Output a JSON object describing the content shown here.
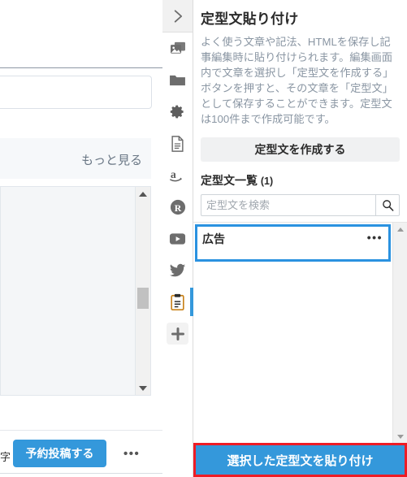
{
  "host": {
    "more_link": "もっと見る",
    "char_count_label": "字",
    "schedule_button": "予約投稿する",
    "kebab": "•••"
  },
  "rail": {
    "items": [
      {
        "name": "chevron-right-icon",
        "label": "パネルを閉じる",
        "state": "active-box"
      },
      {
        "name": "images-icon",
        "label": "画像",
        "state": ""
      },
      {
        "name": "folder-icon",
        "label": "フォルダ",
        "state": ""
      },
      {
        "name": "gear-icon",
        "label": "設定",
        "state": ""
      },
      {
        "name": "document-icon",
        "label": "記事",
        "state": ""
      },
      {
        "name": "amazon-icon",
        "label": "Amazon",
        "state": ""
      },
      {
        "name": "rakuten-icon",
        "label": "楽天",
        "state": ""
      },
      {
        "name": "youtube-icon",
        "label": "YouTube",
        "state": ""
      },
      {
        "name": "twitter-icon",
        "label": "Twitter",
        "state": ""
      },
      {
        "name": "clipboard-icon",
        "label": "定型文貼り付け",
        "state": "current"
      },
      {
        "name": "plus-icon",
        "label": "追加",
        "state": ""
      }
    ]
  },
  "panel": {
    "title": "定型文貼り付け",
    "description": "よく使う文章や記法、HTMLを保存し記事編集時に貼り付けられます。編集画面内で文章を選択し「定型文を作成する」ボタンを押すと、その文章を「定型文」として保存することができます。定型文は100件まで作成可能です。",
    "create_button": "定型文を作成する",
    "list_heading": "定型文一覧",
    "list_count": "(1)",
    "search": {
      "placeholder": "定型文を検索",
      "value": "",
      "icon": "search-icon"
    },
    "snippets": [
      {
        "title": "広告",
        "kebab": "•••",
        "selected": true
      }
    ],
    "paste_button": "選択した定型文を貼り付け"
  },
  "colors": {
    "accent_blue": "#3498db",
    "selection_blue": "#2a92e0",
    "highlight_red": "#ee1c25",
    "muted_text": "#8a96a3",
    "panel_button_bg": "#f0f1f2"
  }
}
